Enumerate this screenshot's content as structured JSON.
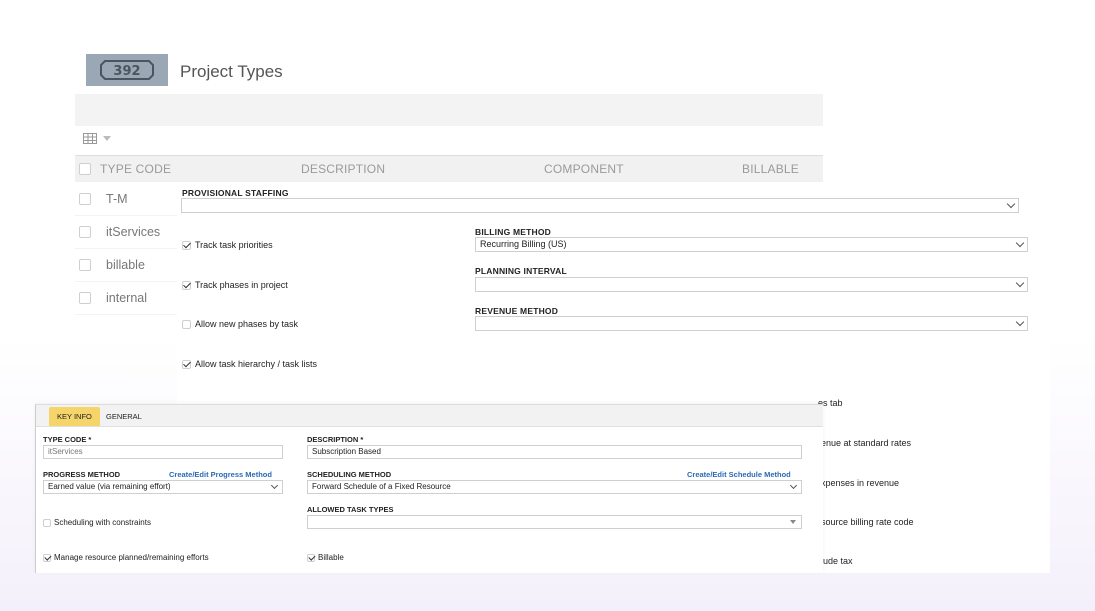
{
  "header": {
    "logo_text": "392",
    "title": "Project Types"
  },
  "table": {
    "columns": [
      "TYPE CODE",
      "DESCRIPTION",
      "COMPONENT",
      "BILLABLE"
    ],
    "rows": [
      {
        "type_code": "T-M"
      },
      {
        "type_code": "itServices"
      },
      {
        "type_code": "billable"
      },
      {
        "type_code": "internal"
      }
    ]
  },
  "settings": {
    "provisional_staffing_label": "PROVISIONAL STAFFING",
    "billing_method_label": "BILLING METHOD",
    "billing_method_value": "Recurring Billing (US)",
    "planning_interval_label": "PLANNING INTERVAL",
    "planning_interval_value": "",
    "revenue_method_label": "REVENUE METHOD",
    "revenue_method_value": "",
    "checks": [
      {
        "label": "Track task priorities",
        "checked": true
      },
      {
        "label": "Track phases in project",
        "checked": true
      },
      {
        "label": "Allow new phases by task",
        "checked": false
      },
      {
        "label": "Allow task hierarchy / task lists",
        "checked": true
      }
    ],
    "clipped_right": [
      "es tab",
      "enue at standard rates",
      "xpenses in revenue",
      "source billing rate code",
      "lude tax"
    ]
  },
  "dialog": {
    "tabs": [
      "KEY INFO",
      "GENERAL"
    ],
    "type_code_label": "TYPE CODE *",
    "type_code_value": "itServices",
    "description_label": "DESCRIPTION *",
    "description_value": "Subscription Based",
    "progress_method_label": "PROGRESS METHOD",
    "progress_method_link": "Create/Edit Progress Method",
    "progress_method_value": "Earned value (via remaining effort)",
    "scheduling_method_label": "SCHEDULING METHOD",
    "scheduling_method_link": "Create/Edit Schedule Method",
    "scheduling_method_value": "Forward Schedule of a Fixed Resource",
    "allowed_task_types_label": "ALLOWED TASK TYPES",
    "allowed_task_types_value": "",
    "scheduling_constraints_label": "Scheduling with constraints",
    "manage_efforts_label": "Manage resource planned/remaining efforts",
    "billable_label": "Billable"
  },
  "colors": {
    "active_tab": "#f5d56a",
    "link": "#2a6ab5",
    "logo_bg": "#9aa7b4"
  }
}
